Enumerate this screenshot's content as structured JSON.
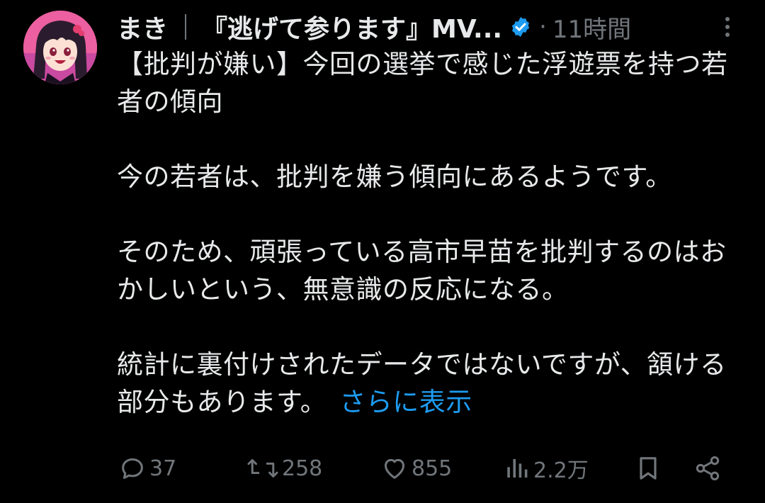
{
  "author": {
    "display_name": "まき",
    "display_name_suffix": "『逃げて参ります』MV...",
    "verified": true,
    "verified_badge_color": "#1d9bf0",
    "timestamp": "11時間",
    "avatar_bg_color": "#f06aa8"
  },
  "tweet": {
    "paragraphs": [
      "【批判が嫌い】今回の選挙で感じた浮遊票を持つ若者の傾向",
      "今の若者は、批判を嫌う傾向にあるようです。",
      "そのため、頑張っている高市早苗を批判するのはおかしいという、無意識の反応になる。",
      "統計に裏付けされたデータではないですが、頷ける部分もあります。"
    ],
    "show_more_label": "さらに表示",
    "link_color": "#1d9bf0"
  },
  "actions": {
    "reply_count": "37",
    "retweet_count": "258",
    "like_count": "855",
    "view_count": "2.2万"
  },
  "icons": {
    "reply": "reply-icon",
    "retweet": "retweet-icon",
    "like": "heart-icon",
    "views": "views-icon",
    "bookmark": "bookmark-icon",
    "share": "share-icon",
    "more": "more-vertical-icon",
    "verified": "verified-badge-icon"
  }
}
